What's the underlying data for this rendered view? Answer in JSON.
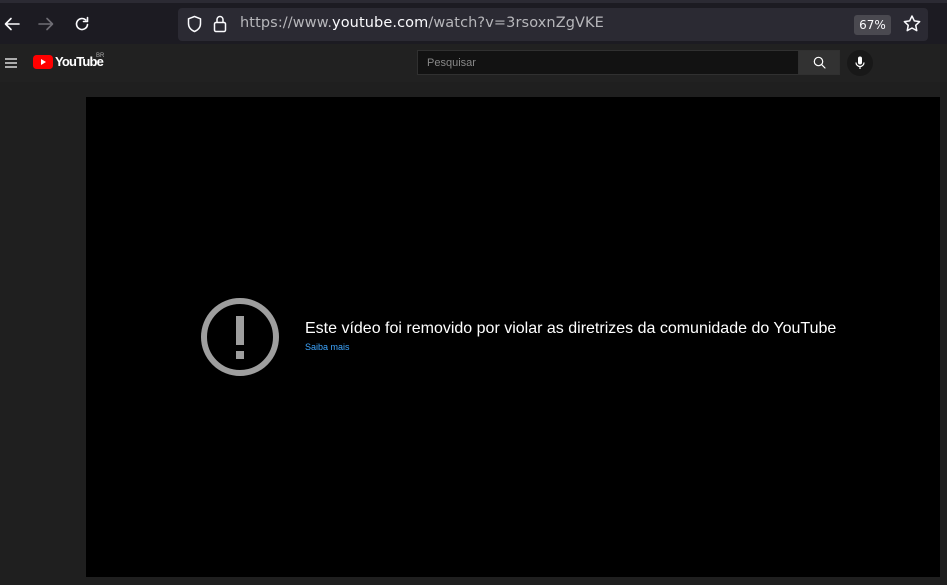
{
  "browser": {
    "url_prefix": "https://www.",
    "url_host": "youtube.com",
    "url_path": "/watch?v=3rsoxnZgVKE",
    "zoom": "67%"
  },
  "youtube": {
    "logo_text": "YouTube",
    "region": "BR",
    "search_placeholder": "Pesquisar"
  },
  "player": {
    "error_message": "Este vídeo foi removido por violar as diretrizes da comunidade do YouTube",
    "learn_more": "Saiba mais"
  },
  "colors": {
    "brand": "#ff0000",
    "link": "#3ea6ff"
  }
}
